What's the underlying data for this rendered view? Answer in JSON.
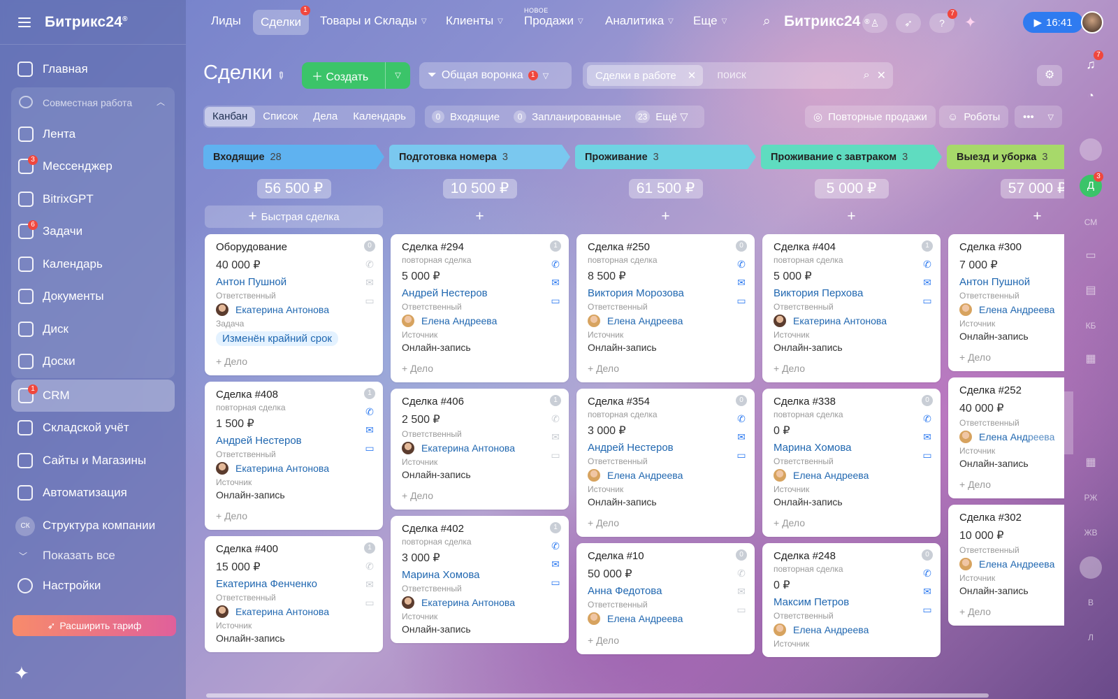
{
  "sidebar": {
    "logo": "Битрикс24",
    "items_top": [
      {
        "label": "Главная",
        "icon": "home-icon"
      }
    ],
    "group": {
      "label": "Совместная работа",
      "items": [
        {
          "label": "Лента",
          "icon": "feed-icon",
          "badge": ""
        },
        {
          "label": "Мессенджер",
          "icon": "messenger-icon",
          "badge": "3"
        },
        {
          "label": "BitrixGPT",
          "icon": "gpt-icon",
          "badge": ""
        },
        {
          "label": "Задачи",
          "icon": "tasks-icon",
          "badge": "6"
        },
        {
          "label": "Календарь",
          "icon": "calendar-icon",
          "badge": ""
        },
        {
          "label": "Документы",
          "icon": "documents-icon",
          "badge": ""
        },
        {
          "label": "Диск",
          "icon": "disk-icon",
          "badge": ""
        },
        {
          "label": "Доски",
          "icon": "boards-icon",
          "badge": ""
        }
      ]
    },
    "crm": {
      "label": "CRM",
      "badge": "1"
    },
    "items_bottom": [
      {
        "label": "Складской учёт",
        "icon": "warehouse-icon"
      },
      {
        "label": "Сайты и Магазины",
        "icon": "cart-icon"
      },
      {
        "label": "Автоматизация",
        "icon": "robot-icon"
      }
    ],
    "structure": {
      "label": "Структура компании",
      "initials": "СК"
    },
    "show_all": "Показать все",
    "settings": "Настройки",
    "upgrade": "Расширить тариф"
  },
  "topbar": {
    "tabs": [
      "Лиды",
      "Сделки",
      "Товары и Склады",
      "Клиенты",
      "Продажи",
      "Аналитика",
      "Еще"
    ],
    "deals_badge": "1",
    "new_tag": "НОВОЕ",
    "logo": "Битрикс24",
    "help_badge": "7",
    "time": "16:41"
  },
  "rail": {
    "bell_badge": "7",
    "d_label": "Д",
    "d_badge": "3",
    "initials": [
      "СМ",
      "КБ",
      "РЖ",
      "ЖВ",
      "В",
      "Л"
    ]
  },
  "header": {
    "title": "Сделки",
    "create": "Создать",
    "funnel": "Общая воронка",
    "funnel_badge": "1",
    "filter_chip": "Сделки в работе",
    "search_placeholder": "поиск"
  },
  "views": {
    "tabs": [
      "Канбан",
      "Список",
      "Дела",
      "Календарь"
    ],
    "counters": [
      {
        "n": "0",
        "label": "Входящие"
      },
      {
        "n": "0",
        "label": "Запланированные"
      },
      {
        "n": "23",
        "label": "Ещё"
      }
    ],
    "repeat_sales": "Повторные продажи",
    "robots": "Роботы"
  },
  "columns": [
    {
      "title": "Входящие",
      "count": "28",
      "sum": "56 500 ₽",
      "quick": "Быстрая сделка",
      "color": "#5fb2f0",
      "cards": [
        {
          "title": "Оборудование",
          "sub": "",
          "amount": "40 000 ₽",
          "client": "Антон Пушной",
          "resp_label": "Ответственный",
          "resp": "Екатерина Антонова",
          "task_label": "Задача",
          "task": "Изменён крайний срок",
          "src_label": "",
          "src": "",
          "add": "+ Дело",
          "counter": "0"
        },
        {
          "title": "Сделка #408",
          "sub": "повторная сделка",
          "amount": "1 500 ₽",
          "client": "Андрей Нестеров",
          "resp_label": "Ответственный",
          "resp": "Екатерина Антонова",
          "task_label": "",
          "task": "",
          "src_label": "Источник",
          "src": "Онлайн-запись",
          "add": "+ Дело",
          "counter": "1"
        },
        {
          "title": "Сделка #400",
          "sub": "",
          "amount": "15 000 ₽",
          "client": "Екатерина Фенченко",
          "resp_label": "Ответственный",
          "resp": "Екатерина Антонова",
          "task_label": "",
          "task": "",
          "src_label": "Источник",
          "src": "Онлайн-запись",
          "add": "",
          "counter": "1"
        }
      ]
    },
    {
      "title": "Подготовка номера",
      "count": "3",
      "sum": "10 500 ₽",
      "quick": "",
      "color": "#7ac8ef",
      "cards": [
        {
          "title": "Сделка #294",
          "sub": "повторная сделка",
          "amount": "5 000 ₽",
          "client": "Андрей Нестеров",
          "resp_label": "Ответственный",
          "resp": "Елена Андреева",
          "task_label": "",
          "task": "",
          "src_label": "Источник",
          "src": "Онлайн-запись",
          "add": "+ Дело",
          "counter": "1"
        },
        {
          "title": "Сделка #406",
          "sub": "",
          "amount": "2 500 ₽",
          "client": "",
          "resp_label": "Ответственный",
          "resp": "Екатерина Антонова",
          "task_label": "",
          "task": "",
          "src_label": "Источник",
          "src": "Онлайн-запись",
          "add": "+ Дело",
          "counter": "1"
        },
        {
          "title": "Сделка #402",
          "sub": "повторная сделка",
          "amount": "3 000 ₽",
          "client": "Марина Хомова",
          "resp_label": "Ответственный",
          "resp": "Екатерина Антонова",
          "task_label": "",
          "task": "",
          "src_label": "Источник",
          "src": "Онлайн-запись",
          "add": "",
          "counter": "1"
        }
      ]
    },
    {
      "title": "Проживание",
      "count": "3",
      "sum": "61 500 ₽",
      "quick": "",
      "color": "#6fd3e3",
      "cards": [
        {
          "title": "Сделка #250",
          "sub": "повторная сделка",
          "amount": "8 500 ₽",
          "client": "Виктория Морозова",
          "resp_label": "Ответственный",
          "resp": "Елена Андреева",
          "task_label": "",
          "task": "",
          "src_label": "Источник",
          "src": "Онлайн-запись",
          "add": "+ Дело",
          "counter": "0"
        },
        {
          "title": "Сделка #354",
          "sub": "повторная сделка",
          "amount": "3 000 ₽",
          "client": "Андрей Нестеров",
          "resp_label": "Ответственный",
          "resp": "Елена Андреева",
          "task_label": "",
          "task": "",
          "src_label": "Источник",
          "src": "Онлайн-запись",
          "add": "+ Дело",
          "counter": "0"
        },
        {
          "title": "Сделка #10",
          "sub": "",
          "amount": "50 000 ₽",
          "client": "Анна Федотова",
          "resp_label": "Ответственный",
          "resp": "Елена Андреева",
          "task_label": "",
          "task": "",
          "src_label": "",
          "src": "",
          "add": "+ Дело",
          "counter": "0"
        }
      ]
    },
    {
      "title": "Проживание с завтраком",
      "count": "3",
      "sum": "5 000 ₽",
      "quick": "",
      "color": "#5fdcc0",
      "cards": [
        {
          "title": "Сделка #404",
          "sub": "повторная сделка",
          "amount": "5 000 ₽",
          "client": "Виктория Перхова",
          "resp_label": "Ответственный",
          "resp": "Екатерина Антонова",
          "task_label": "",
          "task": "",
          "src_label": "Источник",
          "src": "Онлайн-запись",
          "add": "+ Дело",
          "counter": "1"
        },
        {
          "title": "Сделка #338",
          "sub": "повторная сделка",
          "amount": "0 ₽",
          "client": "Марина Хомова",
          "resp_label": "Ответственный",
          "resp": "Елена Андреева",
          "task_label": "",
          "task": "",
          "src_label": "Источник",
          "src": "Онлайн-запись",
          "add": "+ Дело",
          "counter": "0"
        },
        {
          "title": "Сделка #248",
          "sub": "повторная сделка",
          "amount": "0 ₽",
          "client": "Максим Петров",
          "resp_label": "Ответственный",
          "resp": "Елена Андреева",
          "task_label": "Источник",
          "task": "",
          "src_label": "",
          "src": "",
          "add": "",
          "counter": "0"
        }
      ]
    },
    {
      "title": "Выезд и уборка",
      "count": "3",
      "sum": "57 000 ₽",
      "quick": "",
      "color": "#a7d96a",
      "cards": [
        {
          "title": "Сделка #300",
          "sub": "",
          "amount": "7 000 ₽",
          "client": "Антон Пушной",
          "resp_label": "Ответственный",
          "resp": "Елена Андреева",
          "task_label": "",
          "task": "",
          "src_label": "Источник",
          "src": "Онлайн-запись",
          "add": "+ Дело",
          "counter": ""
        },
        {
          "title": "Сделка #252",
          "sub": "",
          "amount": "40 000 ₽",
          "client": "",
          "resp_label": "Ответственный",
          "resp": "Елена Андреева",
          "task_label": "",
          "task": "",
          "src_label": "Источник",
          "src": "Онлайн-запись",
          "add": "+ Дело",
          "counter": ""
        },
        {
          "title": "Сделка #302",
          "sub": "",
          "amount": "10 000 ₽",
          "client": "",
          "resp_label": "Ответственный",
          "resp": "Елена Андреева",
          "task_label": "",
          "task": "",
          "src_label": "Источник",
          "src": "Онлайн-запись",
          "add": "+ Дело",
          "counter": ""
        }
      ]
    }
  ]
}
